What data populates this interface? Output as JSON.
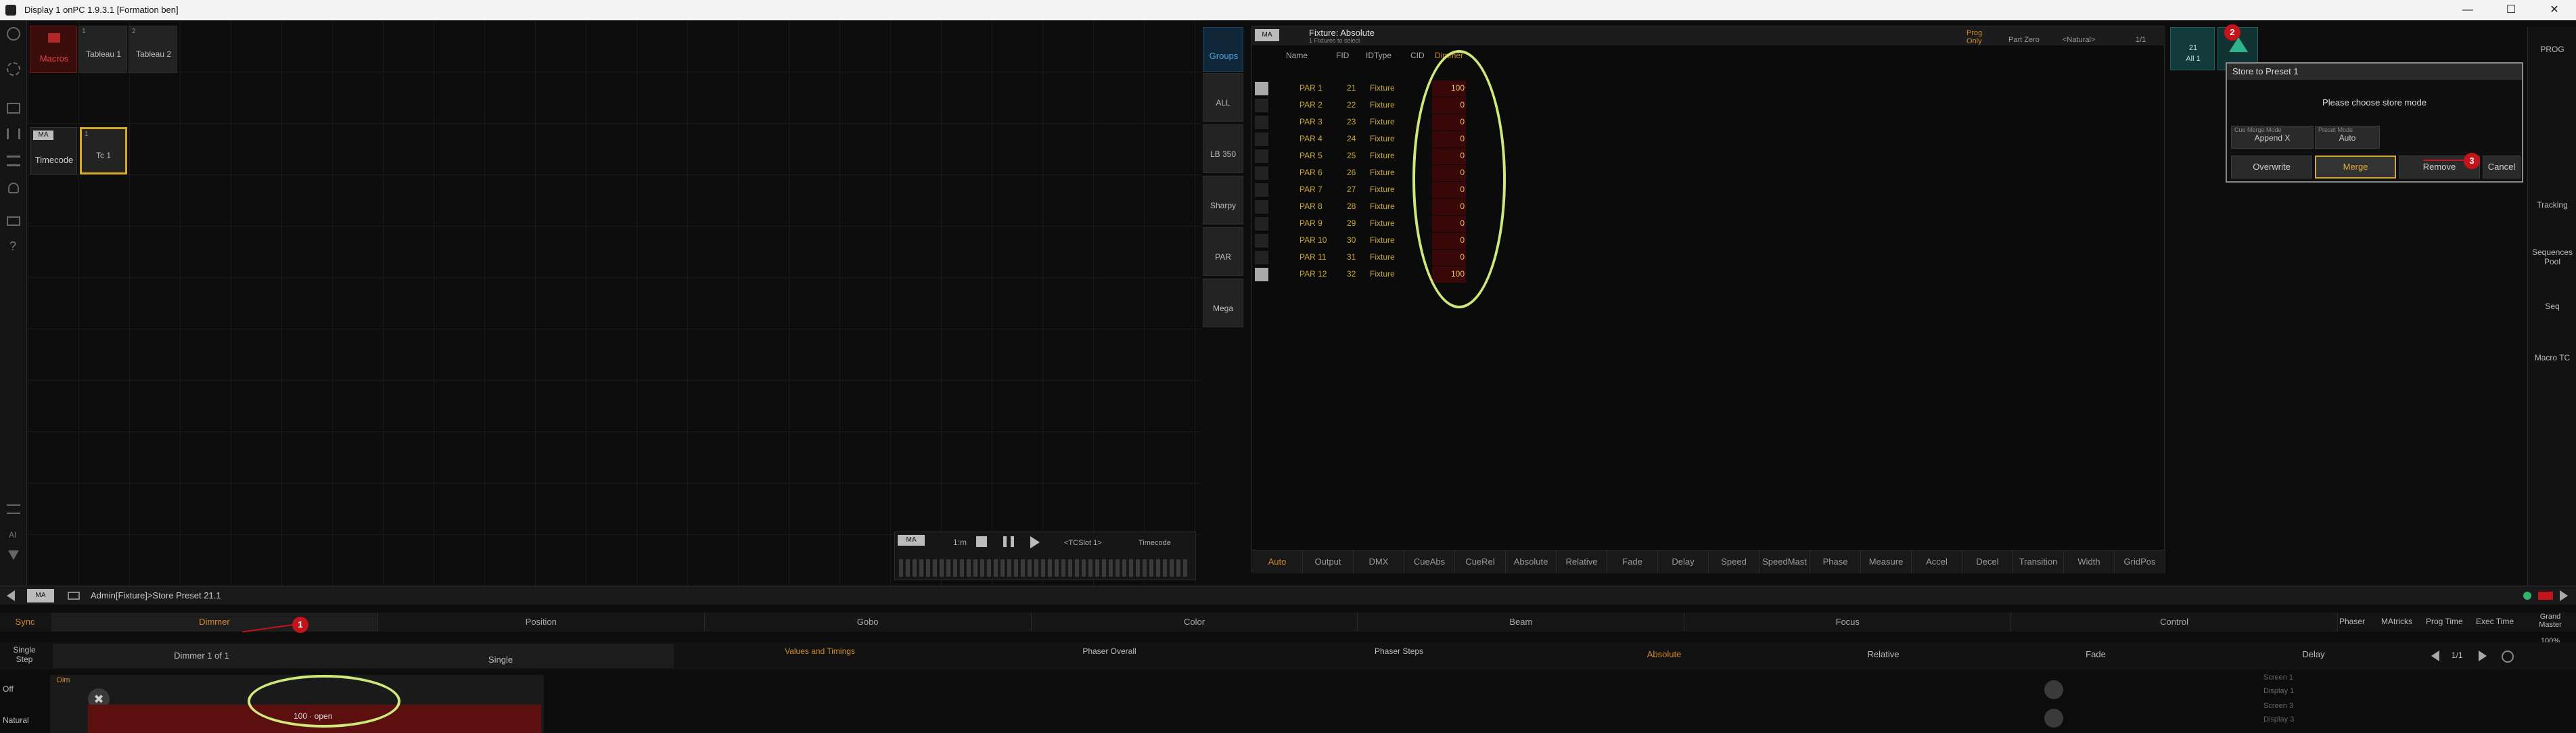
{
  "window": {
    "title": "Display 1 onPC 1.9.3.1 [Formation ben]",
    "minimize": "—",
    "maximize": "☐",
    "close": "✕"
  },
  "left_toolbar": {
    "icons": [
      "power-icon",
      "gear-icon",
      "view-icon",
      "fader-icon",
      "sliders-icon",
      "users-icon",
      "monitor-icon",
      "help-icon",
      "list-icon",
      "ai-icon",
      "filter-icon"
    ],
    "ai_label": "AI"
  },
  "macros_pool": {
    "title": "Macros",
    "items": [
      {
        "num": "1",
        "label": "Tableau 1"
      },
      {
        "num": "2",
        "label": "Tableau 2"
      }
    ]
  },
  "timecode_pool": {
    "title": "Timecode",
    "items": [
      {
        "num": "1",
        "label": "Tc 1"
      }
    ]
  },
  "groups_pool": {
    "title": "Groups",
    "items": [
      "ALL",
      "LB 350",
      "Sharpy",
      "PAR",
      "Mega"
    ]
  },
  "fixture_sheet": {
    "title": "Fixture: Absolute",
    "subtitle": "1 Fixtures to select",
    "prog_only": "Prog Only",
    "part_zero": "Part Zero",
    "natural": "<Natural>",
    "page": "1/1",
    "columns": [
      "Name",
      "FID",
      "IDType",
      "CID",
      "Dimmer"
    ],
    "rows": [
      {
        "name": "PAR 1",
        "fid": "21",
        "type": "Fixture",
        "dimmer": "100"
      },
      {
        "name": "PAR 2",
        "fid": "22",
        "type": "Fixture",
        "dimmer": "0"
      },
      {
        "name": "PAR 3",
        "fid": "23",
        "type": "Fixture",
        "dimmer": "0"
      },
      {
        "name": "PAR 4",
        "fid": "24",
        "type": "Fixture",
        "dimmer": "0"
      },
      {
        "name": "PAR 5",
        "fid": "25",
        "type": "Fixture",
        "dimmer": "0"
      },
      {
        "name": "PAR 6",
        "fid": "26",
        "type": "Fixture",
        "dimmer": "0"
      },
      {
        "name": "PAR 7",
        "fid": "27",
        "type": "Fixture",
        "dimmer": "0"
      },
      {
        "name": "PAR 8",
        "fid": "28",
        "type": "Fixture",
        "dimmer": "0"
      },
      {
        "name": "PAR 9",
        "fid": "29",
        "type": "Fixture",
        "dimmer": "0"
      },
      {
        "name": "PAR 10",
        "fid": "30",
        "type": "Fixture",
        "dimmer": "0"
      },
      {
        "name": "PAR 11",
        "fid": "31",
        "type": "Fixture",
        "dimmer": "0"
      },
      {
        "name": "PAR 12",
        "fid": "32",
        "type": "Fixture",
        "dimmer": "100"
      }
    ],
    "bottom_tabs": [
      "Auto",
      "Output",
      "DMX",
      "CueAbs",
      "CueRel",
      "Absolute",
      "Relative",
      "Fade",
      "Delay",
      "Speed",
      "SpeedMast",
      "Phase",
      "Measure",
      "Accel",
      "Decel",
      "Transition",
      "Width",
      "GridPos"
    ]
  },
  "timecode_bar": {
    "time": "1:m",
    "slot": "<TCSlot 1>",
    "mode": "Timecode"
  },
  "store_dialog": {
    "title": "Store to Preset 1",
    "message": "Please choose store mode",
    "cue_merge_label": "Cue Merge Mode",
    "cue_merge_value": "Append X",
    "preset_mode_label": "Preset Mode",
    "preset_mode_value": "Auto",
    "buttons": [
      "Overwrite",
      "Merge",
      "Remove",
      "Cancel"
    ]
  },
  "preset_pool": {
    "id": "21",
    "label": "All 1"
  },
  "right_sidebar": {
    "items": [
      "PROG",
      "Tracking",
      "Sequences Pool",
      "Seq",
      "Macro TC"
    ]
  },
  "command_line": {
    "text": "Admin[Fixture]>Store Preset 21.1"
  },
  "feature_bar": {
    "sync": "Sync",
    "features": [
      "Dimmer",
      "Position",
      "Gobo",
      "Color",
      "Beam",
      "Focus",
      "Control"
    ],
    "right": [
      "Phaser",
      "MAtricks",
      "Prog Time",
      "Exec Time",
      "Grand Master"
    ],
    "grand_master_value": "100%"
  },
  "attribute_bar": {
    "single_step": "Single Step",
    "dimmer_count": "Dimmer 1 of 1",
    "single": "Single",
    "values_timings": "Values and Timings",
    "phaser_overall": "Phaser Overall",
    "phaser_steps": "Phaser Steps",
    "modes": [
      "Absolute",
      "Relative",
      "Fade",
      "Delay"
    ],
    "page": "1/1"
  },
  "encoder_area": {
    "off": "Off",
    "natural": "Natural",
    "dim_label": "Dim",
    "encoder_value": "100 · open",
    "screens": [
      "Screen 1",
      "Display 1",
      "Screen 3",
      "Display 3"
    ]
  },
  "annotations": [
    "1",
    "2",
    "3"
  ]
}
